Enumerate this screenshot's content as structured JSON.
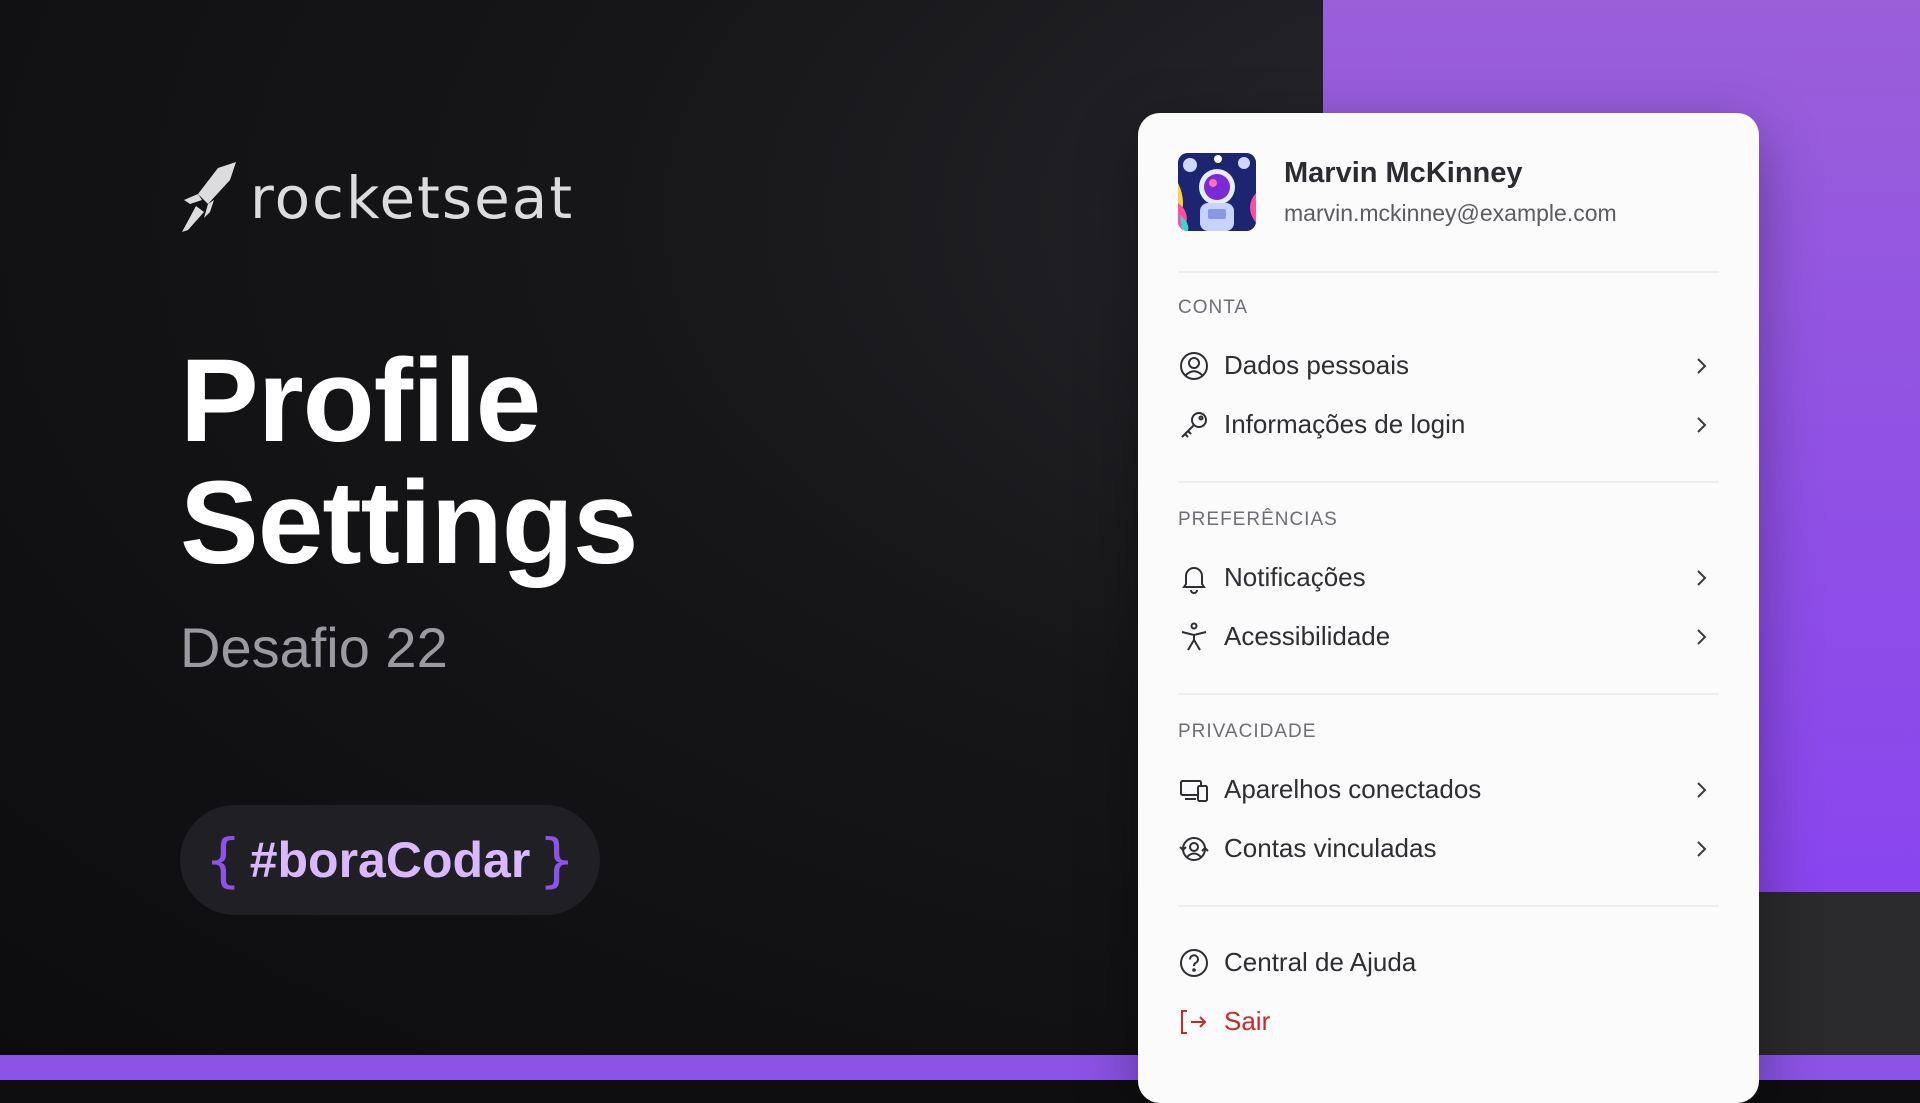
{
  "brand": {
    "name": "rocketseat"
  },
  "hero": {
    "title_line1": "Profile",
    "title_line2": "Settings",
    "subtitle": "Desafio 22",
    "tag_open": "{",
    "tag_text": "#boraCodar",
    "tag_close": "}"
  },
  "colors": {
    "accent": "#8b53e6",
    "danger": "#c62a2a",
    "card_bg": "#fbfbfc"
  },
  "profile": {
    "name": "Marvin McKinney",
    "email": "marvin.mckinney@example.com"
  },
  "sections": {
    "account": {
      "title": "CONTA",
      "items": [
        {
          "label": "Dados pessoais",
          "icon": "user-circle-icon"
        },
        {
          "label": "Informações de login",
          "icon": "key-icon"
        }
      ]
    },
    "preferences": {
      "title": "PREFERÊNCIAS",
      "items": [
        {
          "label": "Notificações",
          "icon": "bell-icon"
        },
        {
          "label": "Acessibilidade",
          "icon": "accessibility-icon"
        }
      ]
    },
    "privacy": {
      "title": "PRIVACIDADE",
      "items": [
        {
          "label": "Aparelhos conectados",
          "icon": "devices-icon"
        },
        {
          "label": "Contas vinculadas",
          "icon": "linked-accounts-icon"
        }
      ]
    },
    "footer": {
      "items": [
        {
          "label": "Central de Ajuda",
          "icon": "help-circle-icon"
        },
        {
          "label": "Sair",
          "icon": "logout-icon"
        }
      ]
    }
  }
}
